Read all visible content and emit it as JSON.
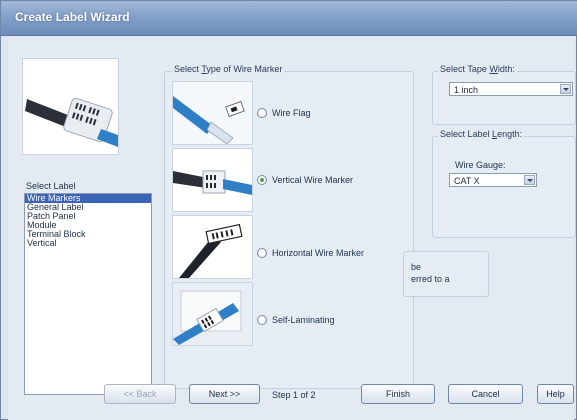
{
  "window": {
    "title": "Create Label Wizard"
  },
  "select_label": {
    "caption": "Select Label",
    "items": [
      "Wire Markers",
      "General Label",
      "Patch Panel",
      "Module",
      "Terminal Block",
      "Vertical"
    ],
    "selected_index": 0
  },
  "wire_marker_type": {
    "caption_pre": "Select ",
    "caption_hotkey": "T",
    "caption_post": "ype of Wire Marker",
    "options": [
      {
        "label": "Wire Flag",
        "checked": false
      },
      {
        "label": "Vertical Wire Marker",
        "checked": true
      },
      {
        "label": "Horizontal Wire Marker",
        "checked": false
      },
      {
        "label": "Self-Laminating",
        "checked": false
      }
    ]
  },
  "tape_width": {
    "caption_pre": "Select Tape ",
    "caption_hotkey": "W",
    "caption_post": "idth:",
    "value": "1 inch"
  },
  "label_length": {
    "caption_pre": "Select Label ",
    "caption_hotkey": "L",
    "caption_post": "ength:",
    "wire_gauge_label": "Wire Gauge:",
    "wire_gauge_value": "CAT X"
  },
  "info_text": {
    "line1": "be",
    "line2": "erred to a"
  },
  "footer": {
    "back_label": "<< Back",
    "next_label": "Next >>",
    "step_text": "Step 1 of 2",
    "finish_label": "Finish",
    "cancel_label": "Cancel",
    "help_label": "Help"
  },
  "colors": {
    "title_bar": "#7f9cc6",
    "selection": "#3a64b6",
    "radio_checked": "#4aa24a",
    "cable_blue": "#2f7fc6"
  }
}
